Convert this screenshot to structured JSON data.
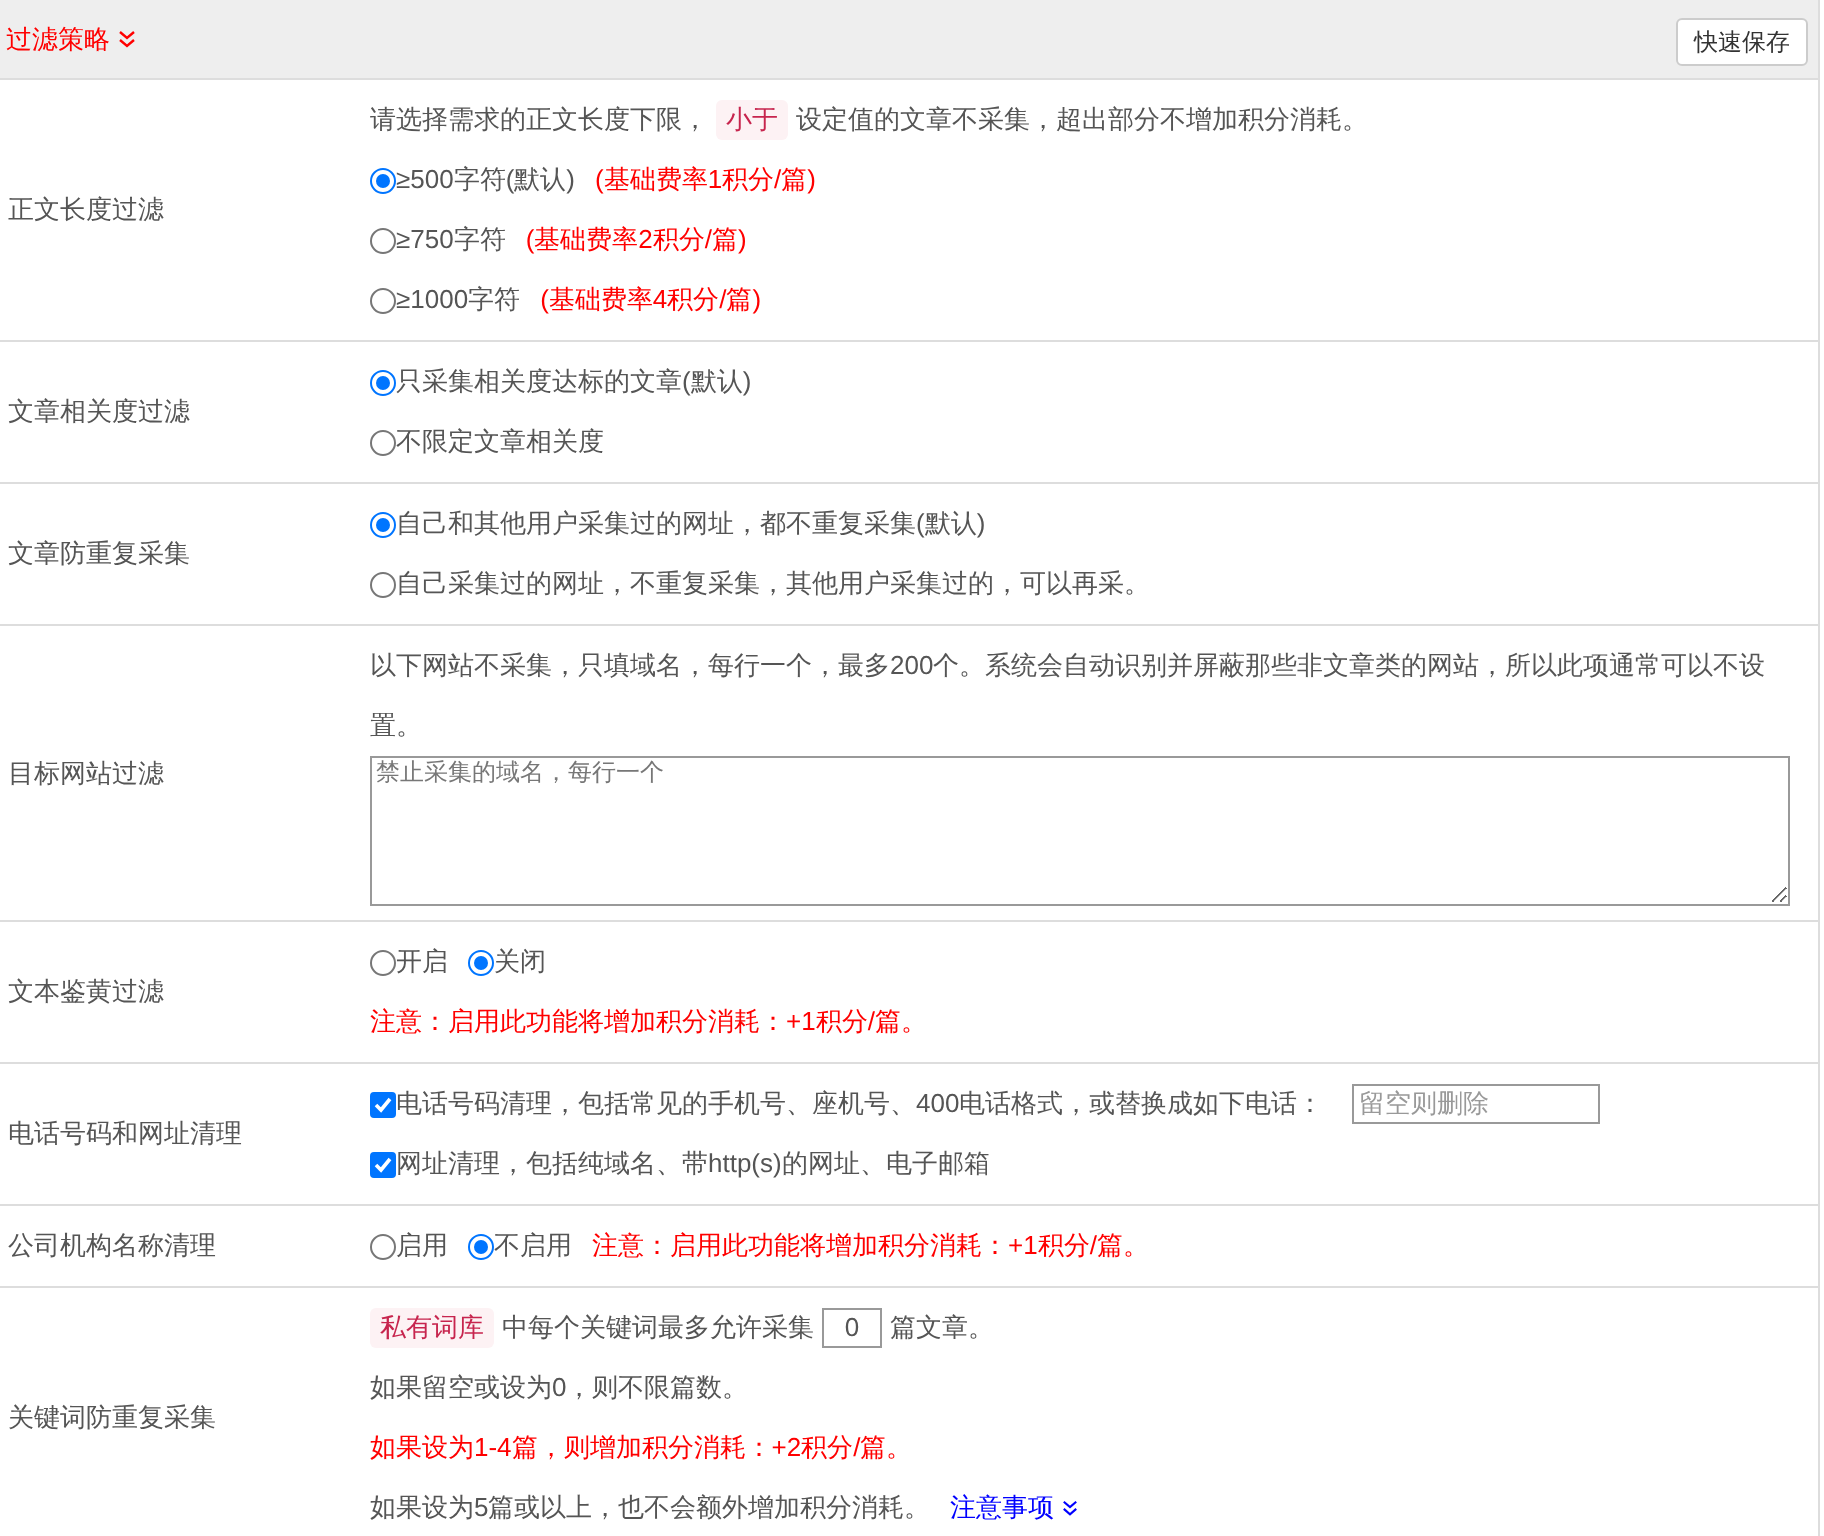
{
  "header": {
    "title": "过滤策略",
    "save_button": "快速保存"
  },
  "rows": [
    {
      "label": "正文长度过滤",
      "lines": [
        [
          {
            "kind": "text",
            "text": "请选择需求的正文长度下限，"
          },
          {
            "kind": "tag",
            "text": "小于"
          },
          {
            "kind": "text",
            "text": "设定值的文章不采集，超出部分不增加积分消耗。"
          }
        ],
        [
          {
            "kind": "radio",
            "text": "≥500字符(默认)",
            "selected": true
          },
          {
            "kind": "warning",
            "text": "(基础费率1积分/篇)"
          }
        ],
        [
          {
            "kind": "radio",
            "text": "≥750字符",
            "selected": false
          },
          {
            "kind": "warning",
            "text": "(基础费率2积分/篇)"
          }
        ],
        [
          {
            "kind": "radio",
            "text": "≥1000字符",
            "selected": false
          },
          {
            "kind": "warning",
            "text": "(基础费率4积分/篇)"
          }
        ]
      ]
    },
    {
      "label": "文章相关度过滤",
      "lines": [
        [
          {
            "kind": "radio",
            "text": "只采集相关度达标的文章(默认)",
            "selected": true
          }
        ],
        [
          {
            "kind": "radio",
            "text": "不限定文章相关度",
            "selected": false
          }
        ]
      ]
    },
    {
      "label": "文章防重复采集",
      "lines": [
        [
          {
            "kind": "radio",
            "text": "自己和其他用户采集过的网址，都不重复采集(默认)",
            "selected": true
          }
        ],
        [
          {
            "kind": "radio",
            "text": "自己采集过的网址，不重复采集，其他用户采集过的，可以再采。",
            "selected": false
          }
        ]
      ]
    },
    {
      "label": "目标网站过滤",
      "lines": [
        [
          {
            "kind": "text",
            "text": "以下网站不采集，只填域名，每行一个，最多200个。系统会自动识别并屏蔽那些非文章类的网站，所以此项通常可以不设置。"
          }
        ],
        [
          {
            "kind": "textarea",
            "placeholder": "禁止采集的域名，每行一个"
          }
        ]
      ]
    },
    {
      "label": "文本鉴黄过滤",
      "lines": [
        [
          {
            "kind": "radio",
            "text": "开启",
            "selected": false
          },
          {
            "kind": "radio",
            "text": "关闭",
            "selected": true
          }
        ],
        [
          {
            "kind": "warning",
            "text": "注意：启用此功能将增加积分消耗：+1积分/篇。"
          }
        ]
      ]
    },
    {
      "label": "电话号码和网址清理",
      "lines": [
        [
          {
            "kind": "checkbox",
            "text": "电话号码清理，包括常见的手机号、座机号、400电话格式，或替换成如下电话：",
            "checked": true
          },
          {
            "kind": "input",
            "placeholder": "留空则删除"
          }
        ],
        [
          {
            "kind": "checkbox",
            "text": "网址清理，包括纯域名、带http(s)的网址、电子邮箱",
            "checked": true
          }
        ]
      ]
    },
    {
      "label": "公司机构名称清理",
      "lines": [
        [
          {
            "kind": "radio",
            "text": "启用",
            "selected": false
          },
          {
            "kind": "radio",
            "text": "不启用",
            "selected": true
          },
          {
            "kind": "warning",
            "text": "注意：启用此功能将增加积分消耗：+1积分/篇。"
          }
        ]
      ]
    },
    {
      "label": "关键词防重复采集",
      "lines": [
        [
          {
            "kind": "tag",
            "text": "私有词库"
          },
          {
            "kind": "text",
            "text": "中每个关键词最多允许采集"
          },
          {
            "kind": "number",
            "value": "0"
          },
          {
            "kind": "text",
            "text": "篇文章。"
          }
        ],
        [
          {
            "kind": "text",
            "text": "如果留空或设为0，则不限篇数。"
          }
        ],
        [
          {
            "kind": "warning",
            "text": "如果设为1-4篇，则增加积分消耗：+2积分/篇。"
          }
        ],
        [
          {
            "kind": "text",
            "text": "如果设为5篇或以上，也不会额外增加积分消耗。"
          },
          {
            "kind": "link",
            "text": "注意事项"
          }
        ]
      ]
    }
  ]
}
